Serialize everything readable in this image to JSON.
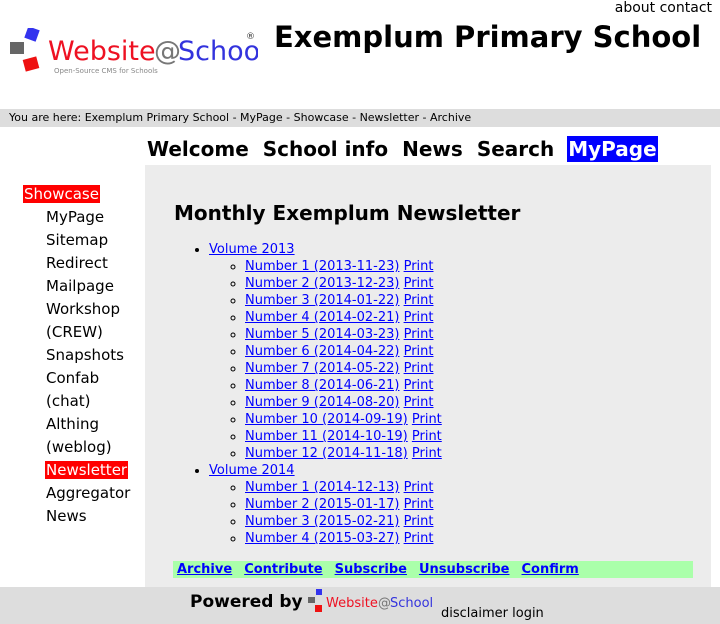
{
  "top_links": [
    "about",
    "contact"
  ],
  "logo": {
    "text": "Website@School",
    "tagline": "Open-Source CMS for Schools"
  },
  "site_name": "Exemplum Primary School",
  "breadcrumb": "You are here: Exemplum Primary School - MyPage - Showcase - Newsletter - Archive",
  "nav": [
    {
      "label": "Welcome"
    },
    {
      "label": "School info"
    },
    {
      "label": "News"
    },
    {
      "label": "Search"
    },
    {
      "label": "MyPage",
      "active": true
    }
  ],
  "menu": {
    "parent": "Showcase",
    "items": [
      "MyPage",
      "Sitemap",
      "Redirect",
      "Mailpage",
      "Workshop",
      "(CREW)",
      "Snapshots",
      "Confab",
      "(chat)",
      "Althing",
      "(weblog)",
      "Newsletter",
      "Aggregator",
      "News"
    ],
    "active": "Newsletter"
  },
  "content": {
    "title": "Monthly Exemplum Newsletter",
    "volumes": [
      {
        "label": "Volume 2013",
        "issues": [
          "Number 1 (2013-11-23)",
          "Number 2 (2013-12-23)",
          "Number 3 (2014-01-22)",
          "Number 4 (2014-02-21)",
          "Number 5 (2014-03-23)",
          "Number 6 (2014-04-22)",
          "Number 7 (2014-05-22)",
          "Number 8 (2014-06-21)",
          "Number 9 (2014-08-20)",
          "Number 10 (2014-09-19)",
          "Number 11 (2014-10-19)",
          "Number 12 (2014-11-18)"
        ]
      },
      {
        "label": "Volume 2014",
        "issues": [
          "Number 1 (2014-12-13)",
          "Number 2 (2015-01-17)",
          "Number 3 (2015-02-21)",
          "Number 4 (2015-03-27)"
        ]
      }
    ],
    "print_label": "Print",
    "actions": [
      "Archive",
      "Contribute",
      "Subscribe",
      "Unsubscribe",
      "Confirm"
    ]
  },
  "footer": {
    "powered_by": "Powered by",
    "links": [
      "disclaimer",
      "login"
    ]
  },
  "colors": {
    "active_nav": "#0000ff",
    "active_menu": "#ff0000",
    "action_bar": "#aaffaa",
    "content_bg": "#ececec"
  }
}
